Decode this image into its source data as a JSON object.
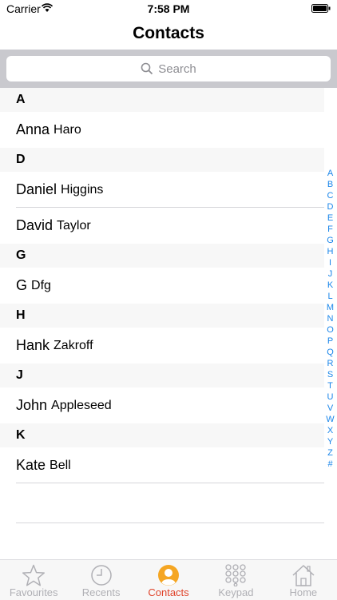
{
  "status": {
    "carrier": "Carrier",
    "time": "7:58 PM"
  },
  "nav": {
    "title": "Contacts"
  },
  "search": {
    "placeholder": "Search"
  },
  "sections": [
    {
      "letter": "A",
      "contacts": [
        {
          "first": "Anna",
          "last": "Haro"
        }
      ]
    },
    {
      "letter": "D",
      "contacts": [
        {
          "first": "Daniel",
          "last": "Higgins"
        },
        {
          "first": "David",
          "last": "Taylor"
        }
      ]
    },
    {
      "letter": "G",
      "contacts": [
        {
          "first": "G",
          "last": "Dfg"
        }
      ]
    },
    {
      "letter": "H",
      "contacts": [
        {
          "first": "Hank",
          "last": "Zakroff"
        }
      ]
    },
    {
      "letter": "J",
      "contacts": [
        {
          "first": "John",
          "last": "Appleseed"
        }
      ]
    },
    {
      "letter": "K",
      "contacts": [
        {
          "first": "Kate",
          "last": "Bell"
        }
      ]
    }
  ],
  "index": [
    "A",
    "B",
    "C",
    "D",
    "E",
    "F",
    "G",
    "H",
    "I",
    "J",
    "K",
    "L",
    "M",
    "N",
    "O",
    "P",
    "Q",
    "R",
    "S",
    "T",
    "U",
    "V",
    "W",
    "X",
    "Y",
    "Z",
    "#"
  ],
  "tabs": [
    {
      "label": "Favourites",
      "icon": "star-icon",
      "active": false
    },
    {
      "label": "Recents",
      "icon": "clock-icon",
      "active": false
    },
    {
      "label": "Contacts",
      "icon": "person-icon",
      "active": true
    },
    {
      "label": "Keypad",
      "icon": "keypad-icon",
      "active": false
    },
    {
      "label": "Home",
      "icon": "home-icon",
      "active": false
    }
  ],
  "colors": {
    "accent": "#e0442b",
    "index": "#1a86ea",
    "inactive": "#b0b0b5"
  }
}
